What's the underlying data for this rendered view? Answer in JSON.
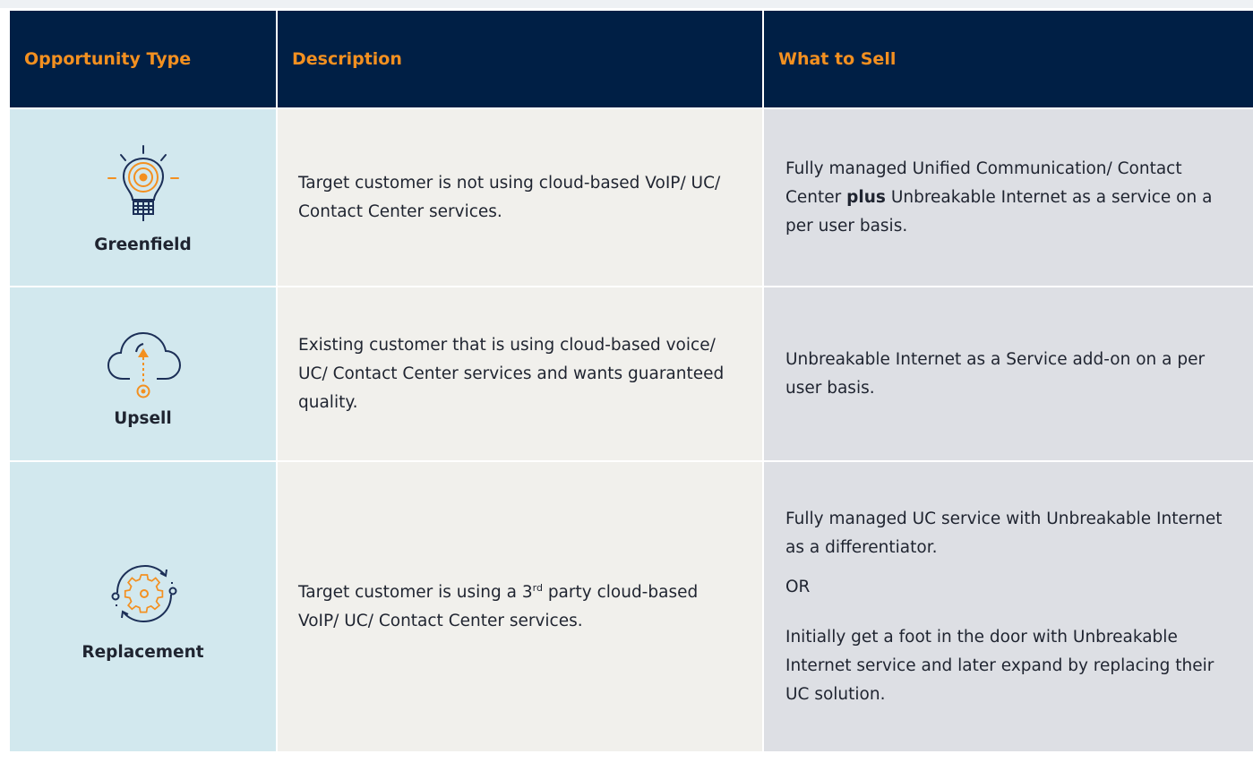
{
  "headers": {
    "type": "Opportunity Type",
    "description": "Description",
    "what_to_sell": "What to Sell"
  },
  "rows": [
    {
      "type": "Greenfield",
      "icon": "lightbulb-target-icon",
      "description": "Target customer is not using cloud-based VoIP/ UC/ Contact Center services.",
      "sell_pre": "Fully managed Unified Communication/ Contact Center ",
      "sell_bold": "plus",
      "sell_post": " Unbreakable Internet as a service on a per user basis."
    },
    {
      "type": "Upsell",
      "icon": "cloud-upload-icon",
      "description": "Existing customer that is using cloud-based voice/ UC/ Contact Center services and wants guaranteed quality.",
      "sell": "Unbreakable Internet as a Service add-on on a per user basis."
    },
    {
      "type": "Replacement",
      "icon": "gear-cycle-icon",
      "description_pre": "Target customer is using a 3",
      "description_sup": "rd",
      "description_post": " party cloud-based VoIP/ UC/ Contact Center services.",
      "sell_1": "Fully managed UC service with Unbreakable Internet as a differentiator.",
      "sell_or": "OR",
      "sell_2": "Initially get a foot in the door with Unbreakable Internet service and later expand by replacing their UC solution."
    }
  ],
  "colors": {
    "header_bg": "#001f45",
    "header_text": "#f39020",
    "type_bg": "#d2e8ee",
    "desc_bg": "#f1f0ec",
    "sell_bg": "#dddfe4",
    "icon_navy": "#1c2f57",
    "icon_orange": "#f39020"
  }
}
